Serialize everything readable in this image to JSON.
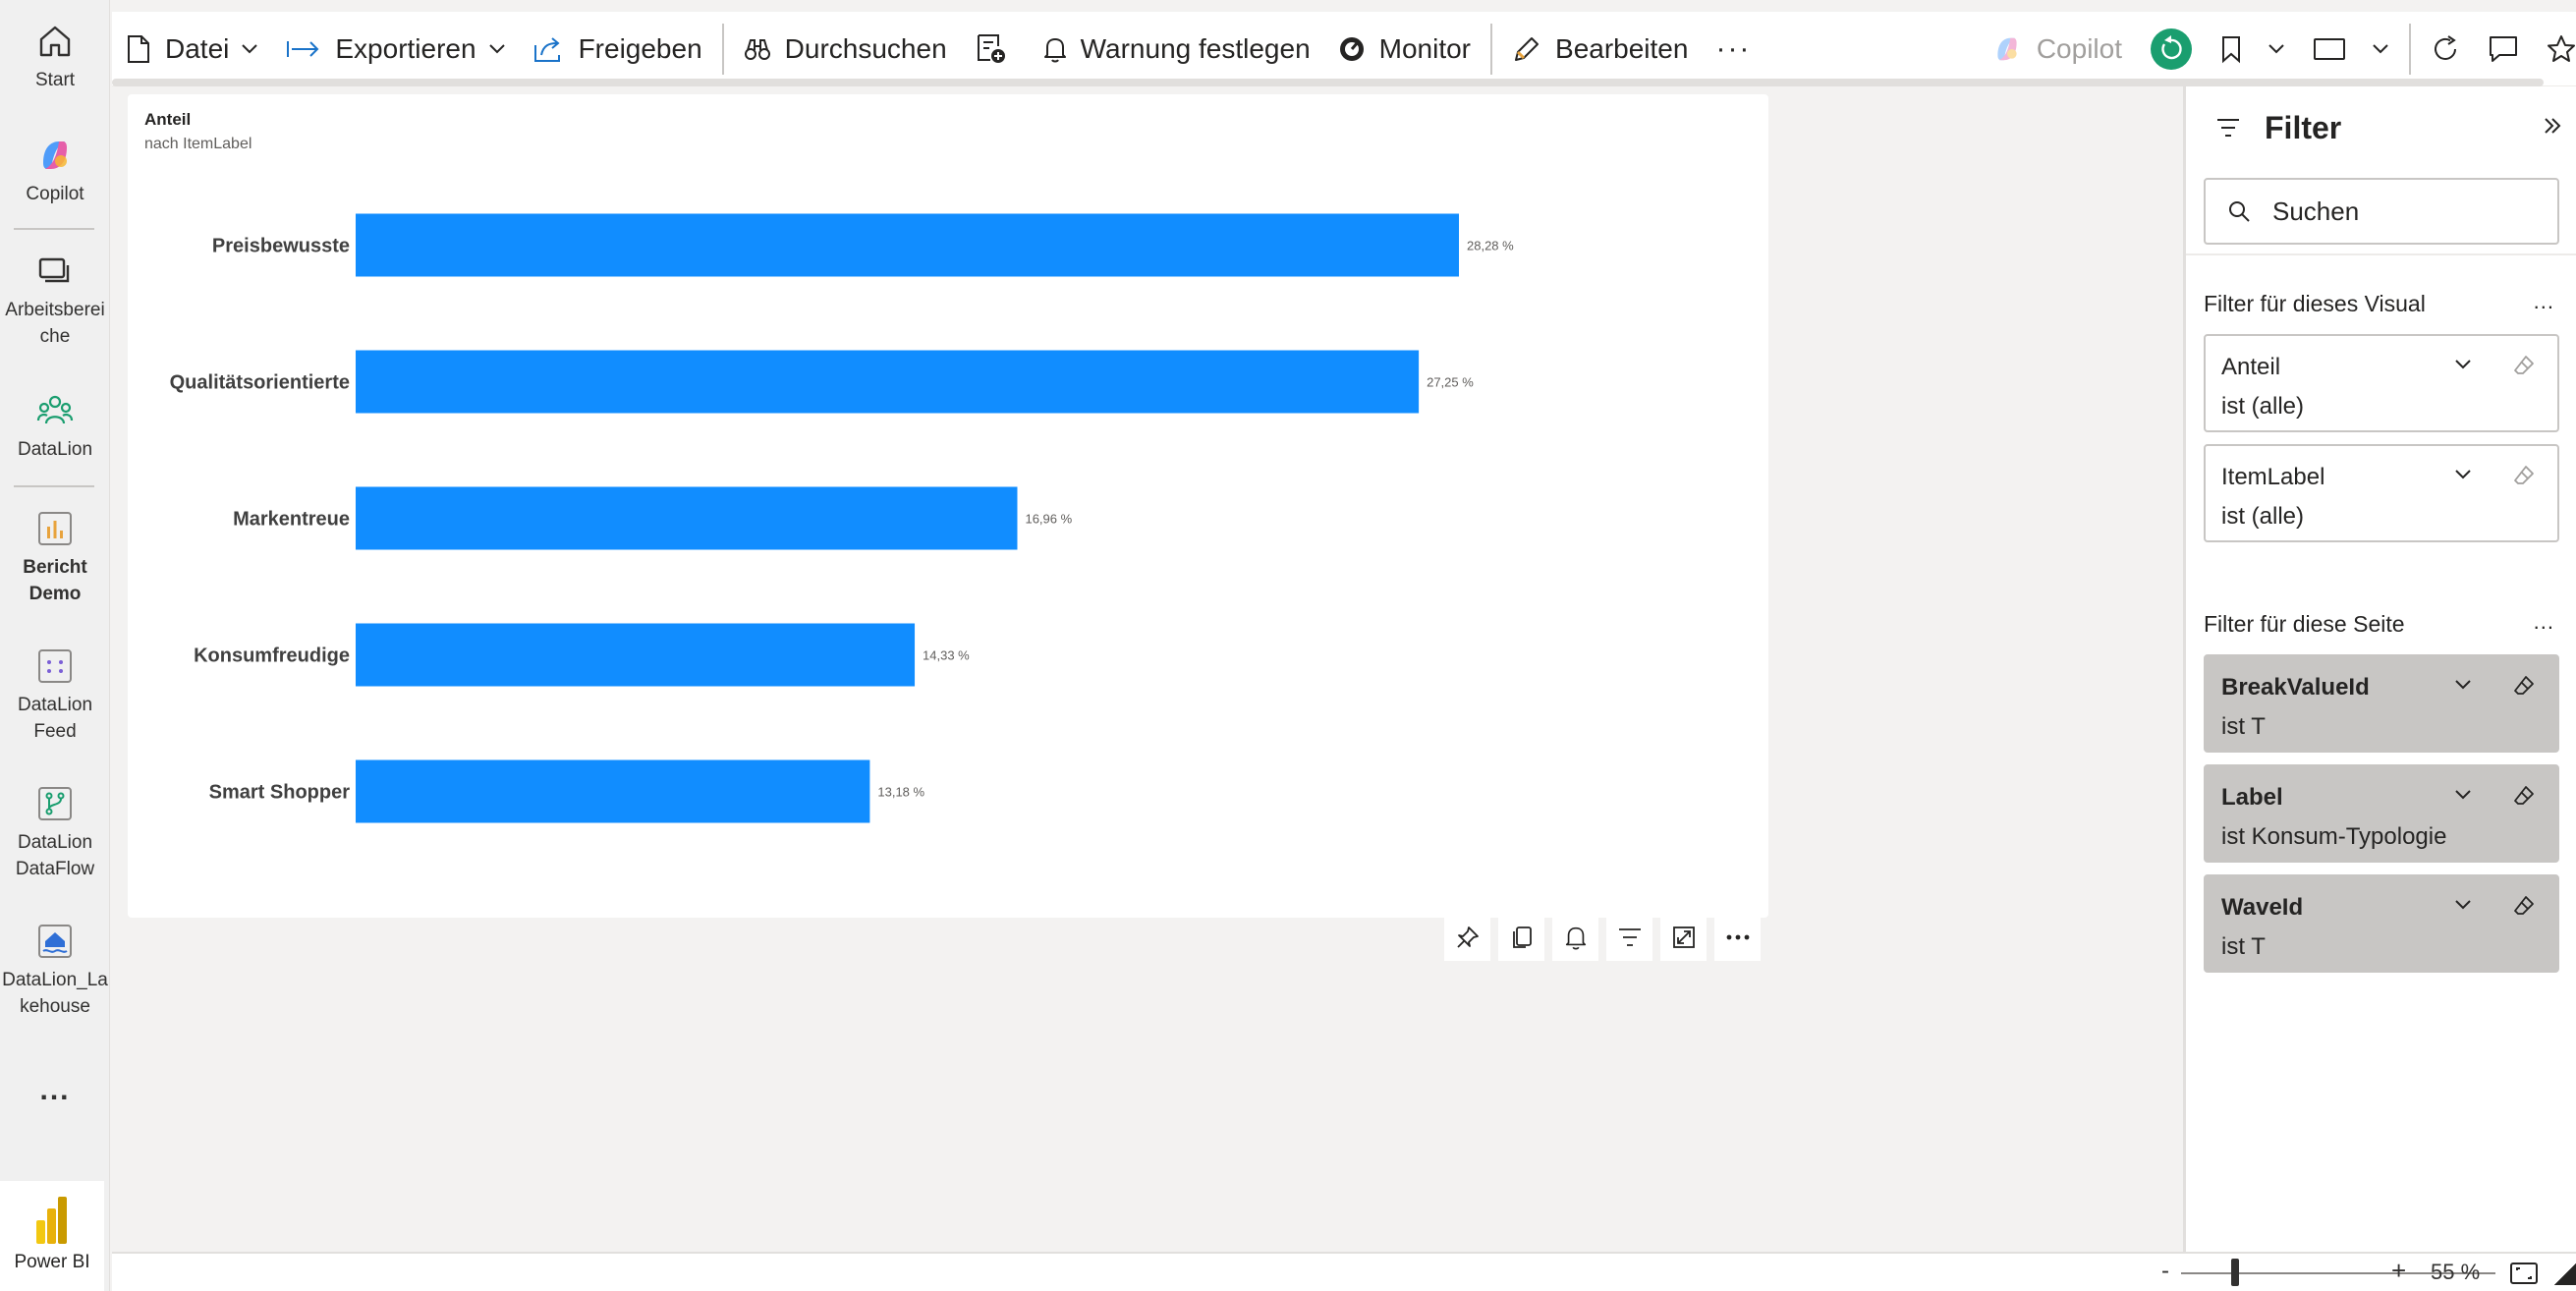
{
  "rail": {
    "items": [
      {
        "label": "Start",
        "icon": "home-icon"
      },
      {
        "label": "Copilot",
        "icon": "copilot-icon"
      },
      {
        "label": "Arbeitsbereiche",
        "label_line1": "Arbeitsberei",
        "label_line2": "che",
        "icon": "workspaces-icon"
      },
      {
        "label": "DataLion",
        "icon": "group-icon"
      },
      {
        "label": "Bericht Demo",
        "label_line1": "Bericht",
        "label_line2": "Demo",
        "icon": "report-icon"
      },
      {
        "label": "DataLion Feed",
        "label_line1": "DataLion",
        "label_line2": "Feed",
        "icon": "feed-icon"
      },
      {
        "label": "DataLion DataFlow",
        "label_line1": "DataLion",
        "label_line2": "DataFlow",
        "icon": "dataflow-icon"
      },
      {
        "label": "DataLion_Lakehouse",
        "label_line1": "DataLion_La",
        "label_line2": "kehouse",
        "icon": "lakehouse-icon"
      }
    ],
    "more": "...",
    "app_label": "Power BI"
  },
  "toolbar": {
    "file": "Datei",
    "export": "Exportieren",
    "share": "Freigeben",
    "explore": "Durchsuchen",
    "alert": "Warnung festlegen",
    "monitor": "Monitor",
    "edit": "Bearbeiten",
    "more": "···",
    "copilot": "Copilot"
  },
  "visual": {
    "title": "Anteil",
    "subtitle": "nach ItemLabel"
  },
  "chart_data": {
    "type": "bar",
    "orientation": "horizontal",
    "title": "Anteil",
    "subtitle": "nach ItemLabel",
    "categories": [
      "Preisbewusste",
      "Qualitätsorientierte",
      "Markentreue",
      "Konsumfreudige",
      "Smart Shopper"
    ],
    "values": [
      28.28,
      27.25,
      16.96,
      14.33,
      13.18
    ],
    "value_labels": [
      "28,28 %",
      "27,25 %",
      "16,96 %",
      "14,33 %",
      "13,18 %"
    ],
    "unit": "%",
    "color": "#118dff",
    "xlim": [
      0,
      28.28
    ],
    "grid": false
  },
  "filter_pane": {
    "title": "Filter",
    "search_placeholder": "Suchen",
    "visual_section": "Filter für dieses Visual",
    "page_section": "Filter für diese Seite",
    "more": "...",
    "visual_filters": [
      {
        "name": "Anteil",
        "value": "ist (alle)"
      },
      {
        "name": "ItemLabel",
        "value": "ist (alle)"
      }
    ],
    "page_filters": [
      {
        "name": "BreakValueId",
        "value": "ist T"
      },
      {
        "name": "Label",
        "value": "ist Konsum-Typologie"
      },
      {
        "name": "WaveId",
        "value": "ist T"
      }
    ]
  },
  "status": {
    "zoom_minus": "-",
    "zoom_plus": "+",
    "zoom": "55 %",
    "zoom_level_percent": 55
  },
  "colors": {
    "accent": "#118dff",
    "copilot_teal": "#1a9e6f"
  }
}
